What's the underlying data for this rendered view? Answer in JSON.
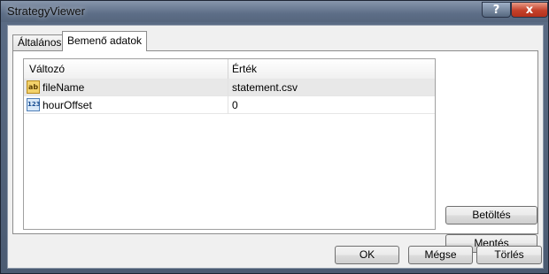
{
  "window": {
    "title": "StrategyViewer",
    "help_label": "?",
    "close_label": "x"
  },
  "tabs": [
    {
      "label": "Általános"
    },
    {
      "label": "Bemenő adatok"
    }
  ],
  "grid": {
    "columns": [
      "Változó",
      "Érték"
    ],
    "rows": [
      {
        "icon": "string-type-icon",
        "icon_text": "ab",
        "name": "fileName",
        "value": "statement.csv"
      },
      {
        "icon": "integer-type-icon",
        "icon_text": "123",
        "name": "hourOffset",
        "value": "0"
      }
    ]
  },
  "side_buttons": {
    "load": "Betöltés",
    "save": "Mentés"
  },
  "footer_buttons": {
    "ok": "OK",
    "cancel": "Mégse",
    "reset": "Törlés"
  }
}
